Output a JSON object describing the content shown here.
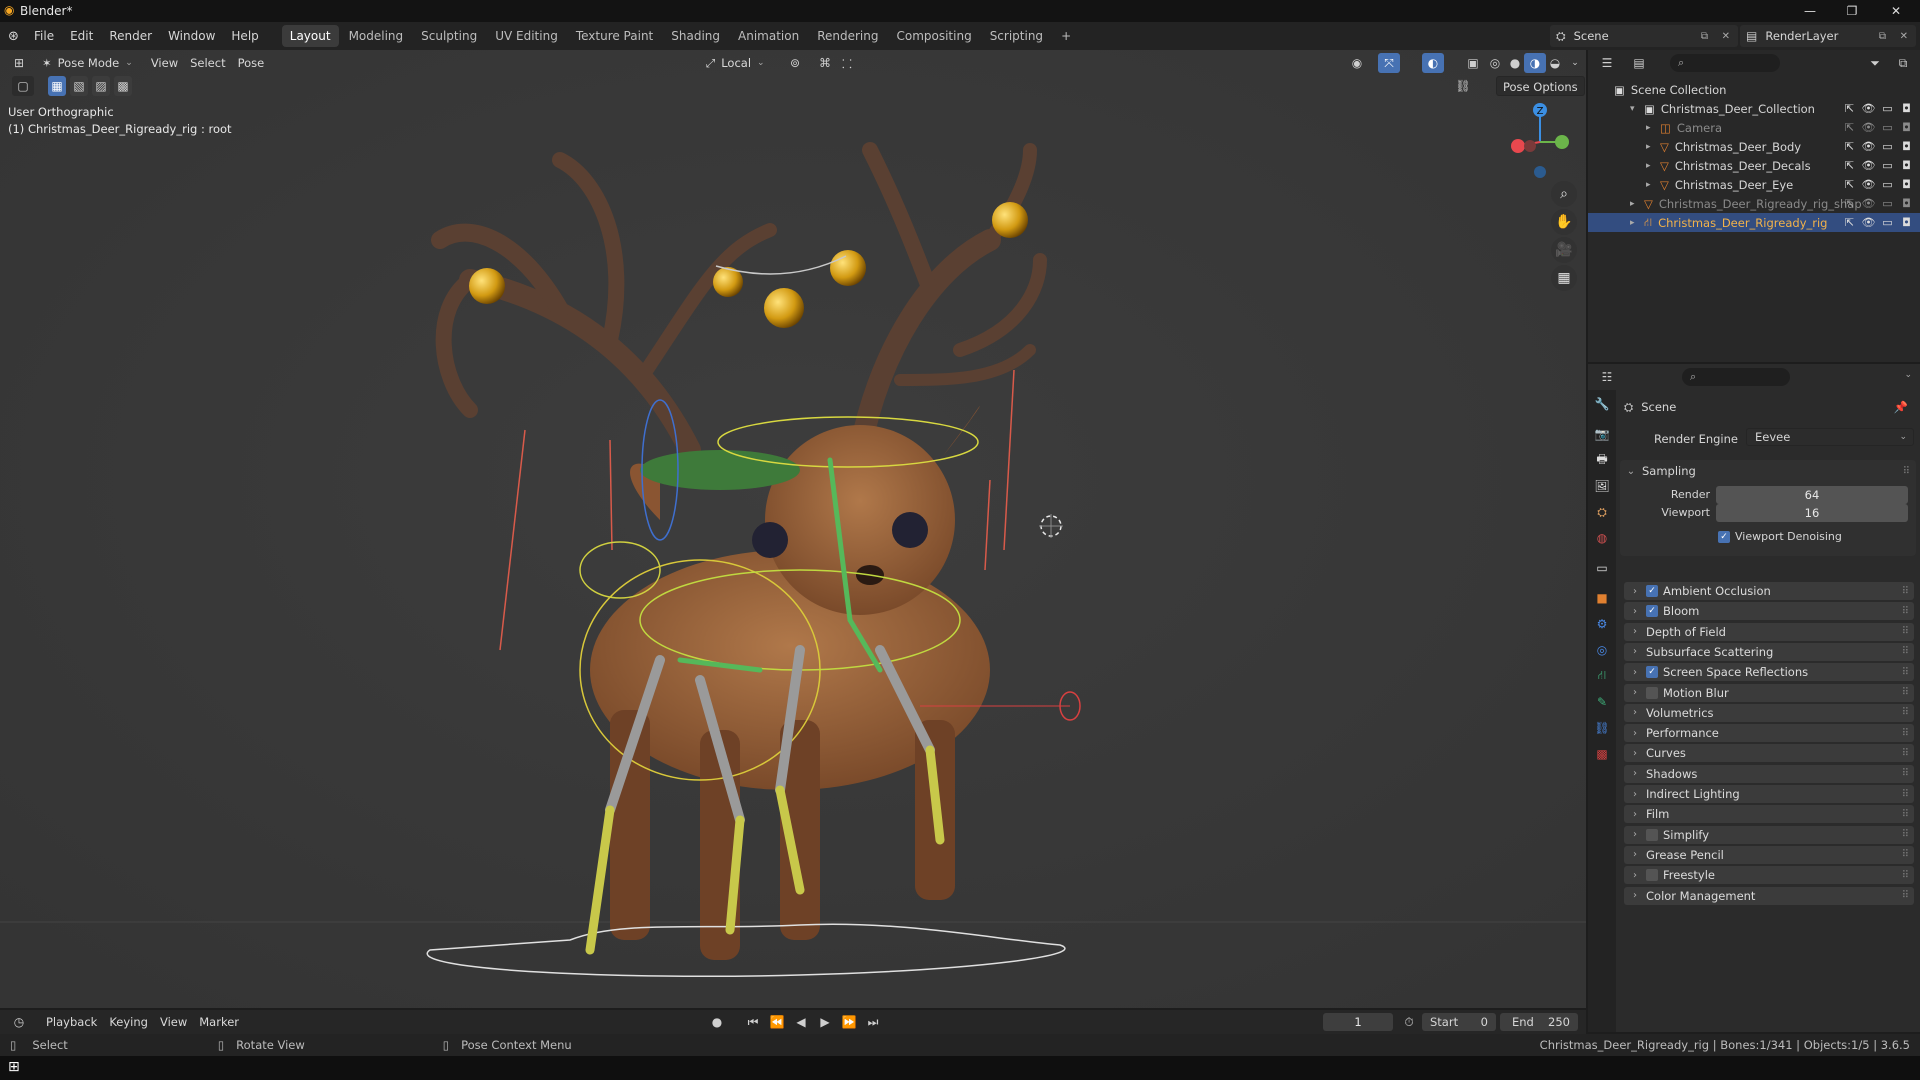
{
  "window": {
    "title": "Blender*",
    "minimize": "—",
    "maximize": "❐",
    "close": "✕"
  },
  "menubar": {
    "items": [
      "File",
      "Edit",
      "Render",
      "Window",
      "Help"
    ],
    "workspaces": [
      "Layout",
      "Modeling",
      "Sculpting",
      "UV Editing",
      "Texture Paint",
      "Shading",
      "Animation",
      "Rendering",
      "Compositing",
      "Scripting"
    ],
    "add_workspace": "+",
    "scene": "Scene",
    "view_layer": "RenderLayer"
  },
  "viewport_header": {
    "mode": "Pose Mode",
    "menus": [
      "View",
      "Select",
      "Pose"
    ],
    "transform_orientation": "Local",
    "pose_options": "Pose Options"
  },
  "viewport": {
    "view_name": "User Orthographic",
    "active_info": "(1) Christmas_Deer_Rigready_rig : root",
    "gizmo_axes": {
      "x_color": "#e8484e",
      "y_color": "#6bb54a",
      "z_color": "#3b8fe3",
      "z_label": "Z"
    },
    "nav_icons": [
      "zoom-icon",
      "pan-hand-icon",
      "camera-icon",
      "grid-icon"
    ]
  },
  "outliner": {
    "root": "Scene Collection",
    "rows": [
      {
        "name": "Christmas_Deer_Collection",
        "indent": 1,
        "dim": false,
        "selected": false
      },
      {
        "name": "Camera",
        "indent": 2,
        "dim": true,
        "selected": false
      },
      {
        "name": "Christmas_Deer_Body",
        "indent": 2,
        "dim": false,
        "selected": false
      },
      {
        "name": "Christmas_Deer_Decals",
        "indent": 2,
        "dim": false,
        "selected": false
      },
      {
        "name": "Christmas_Deer_Eye",
        "indent": 2,
        "dim": false,
        "selected": false
      },
      {
        "name": "Christmas_Deer_Rigready_rig_shap",
        "indent": 1,
        "dim": true,
        "selected": false
      },
      {
        "name": "Christmas_Deer_Rigready_rig",
        "indent": 1,
        "dim": false,
        "selected": true
      }
    ]
  },
  "properties": {
    "context": "Scene",
    "render_engine_label": "Render Engine",
    "render_engine": "Eevee",
    "sampling": {
      "title": "Sampling",
      "render_label": "Render",
      "render_value": "64",
      "viewport_label": "Viewport",
      "viewport_value": "16",
      "denoise_label": "Viewport Denoising"
    },
    "panels": [
      {
        "label": "Ambient Occlusion",
        "checkbox": true
      },
      {
        "label": "Bloom",
        "checkbox": true
      },
      {
        "label": "Depth of Field",
        "checkbox": null
      },
      {
        "label": "Subsurface Scattering",
        "checkbox": null
      },
      {
        "label": "Screen Space Reflections",
        "checkbox": true
      },
      {
        "label": "Motion Blur",
        "checkbox": false
      },
      {
        "label": "Volumetrics",
        "checkbox": null
      },
      {
        "label": "Performance",
        "checkbox": null
      },
      {
        "label": "Curves",
        "checkbox": null
      },
      {
        "label": "Shadows",
        "checkbox": null
      },
      {
        "label": "Indirect Lighting",
        "checkbox": null
      },
      {
        "label": "Film",
        "checkbox": null
      },
      {
        "label": "Simplify",
        "checkbox": false
      },
      {
        "label": "Grease Pencil",
        "checkbox": null
      },
      {
        "label": "Freestyle",
        "checkbox": false
      },
      {
        "label": "Color Management",
        "checkbox": null
      }
    ]
  },
  "timeline": {
    "menus": [
      "Playback",
      "Keying",
      "View",
      "Marker"
    ],
    "current_frame": "1",
    "start_label": "Start",
    "start": "0",
    "end_label": "End",
    "end": "250"
  },
  "statusbar": {
    "select": "Select",
    "rotate": "Rotate View",
    "context_menu": "Pose Context Menu",
    "stats": "Christmas_Deer_Rigready_rig | Bones:1/341 | Objects:1/5 | 3.6.5"
  }
}
